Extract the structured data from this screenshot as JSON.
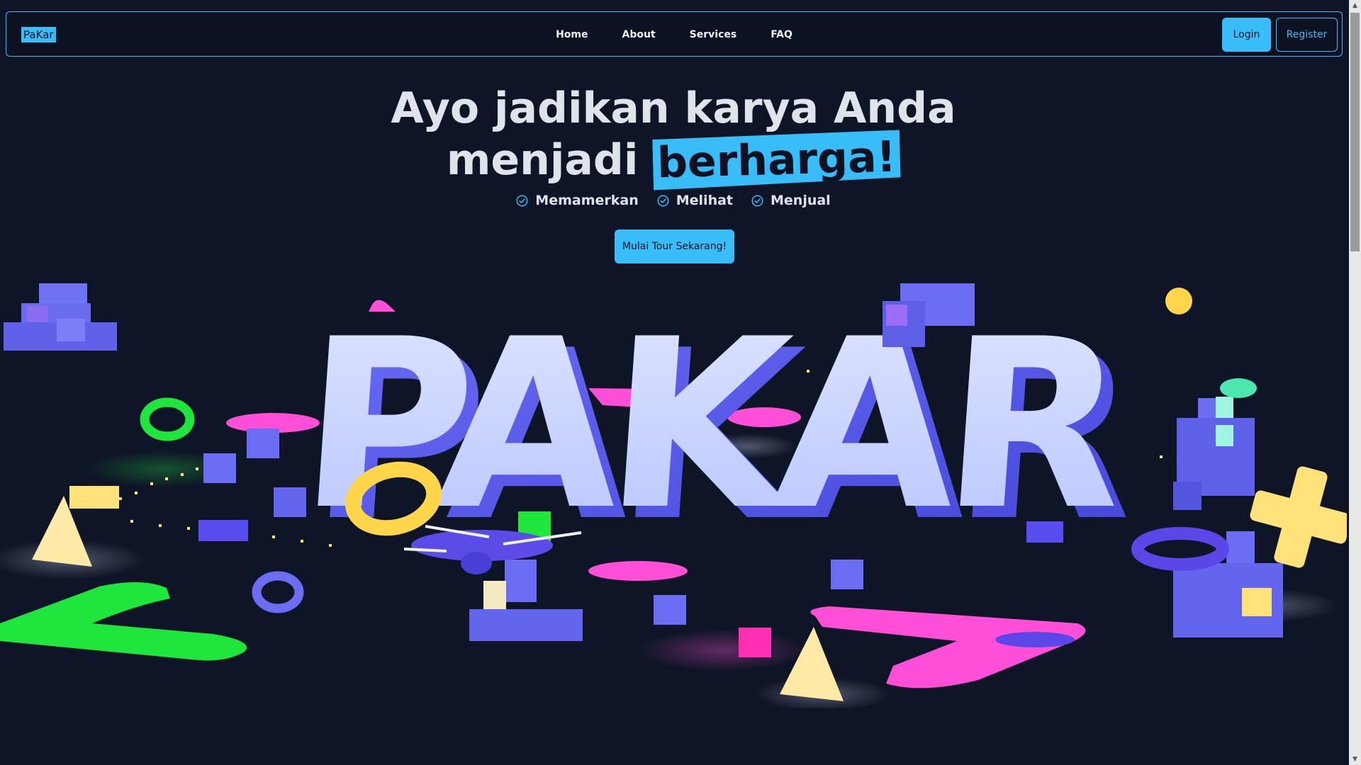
{
  "navbar": {
    "brand": "PaKar",
    "links": [
      "Home",
      "About",
      "Services",
      "FAQ"
    ],
    "login": "Login",
    "register": "Register"
  },
  "hero": {
    "title_line1": "Ayo jadikan karya Anda",
    "title_line2_prefix": "menjadi ",
    "title_highlight": "berharga!",
    "features": [
      "Memamerkan",
      "Melihat",
      "Menjual"
    ],
    "cta": "Mulai Tour Sekarang!"
  },
  "illustration": {
    "word": "PAKAR"
  },
  "colors": {
    "background": "#0e1526",
    "accent": "#38bdf8",
    "letter_face": "#c9d3ff",
    "letter_side": "#5b5bf0",
    "pink": "#ff4fd8",
    "green": "#1ee63c",
    "yellow": "#ffe27a"
  }
}
